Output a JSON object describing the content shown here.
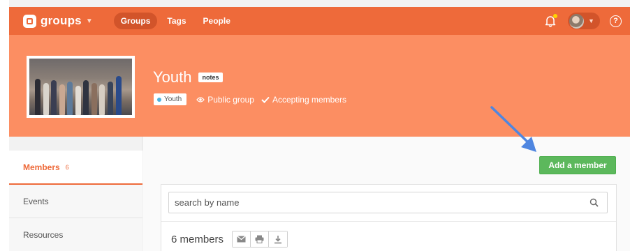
{
  "app": {
    "name": "groups"
  },
  "nav": {
    "tabs": [
      {
        "label": "Groups",
        "active": true
      },
      {
        "label": "Tags",
        "active": false
      },
      {
        "label": "People",
        "active": false
      }
    ],
    "help_glyph": "?"
  },
  "group": {
    "title": "Youth",
    "badge": "notes",
    "tag": "Youth",
    "visibility": "Public group",
    "membership": "Accepting members"
  },
  "sidebar": {
    "items": [
      {
        "label": "Members",
        "count": "6",
        "active": true
      },
      {
        "label": "Events",
        "active": false
      },
      {
        "label": "Resources",
        "active": false
      }
    ]
  },
  "main": {
    "add_button": "Add a member",
    "search_placeholder": "search by name",
    "members_count": "6 members"
  },
  "colors": {
    "nav_bg": "#ee6a3a",
    "hero_bg": "#fc8e62",
    "accent": "#ee6a3a",
    "add_button": "#5cb85c",
    "annotation_arrow": "#4f86e0",
    "tag_dot": "#4ab3e0"
  },
  "icons": [
    "groups-logo-icon",
    "chevron-down-icon",
    "bell-icon",
    "help-icon",
    "eye-icon",
    "checkmark-icon",
    "search-icon",
    "email-icon",
    "print-icon",
    "download-icon"
  ]
}
